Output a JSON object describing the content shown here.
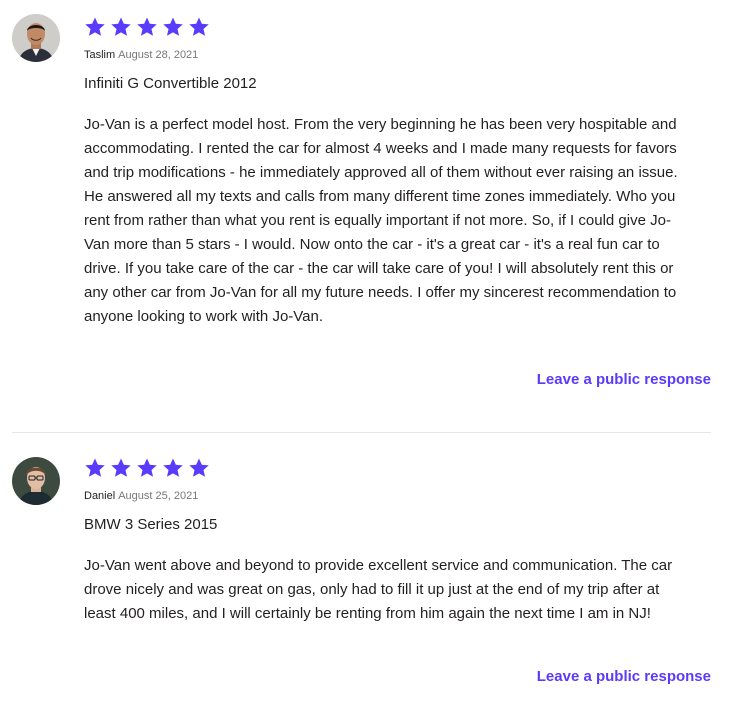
{
  "colors": {
    "accent": "#593cfb",
    "star": "#593cfb",
    "text": "#231f20",
    "muted": "#79767a",
    "divider": "#e5e5e5"
  },
  "reviews": [
    {
      "rating": 5,
      "star_icon": "star-icon",
      "reviewer": "Taslim",
      "date": "August 28, 2021",
      "car": "Infiniti G Convertible 2012",
      "text": "Jo-Van is a perfect model host. From the very beginning he has been very hospitable and accommodating. I rented the car for almost 4 weeks and I made many requests for favors and trip modifications - he immediately approved all of them without ever raising an issue. He answered all my texts and calls from many different time zones immediately. Who you rent from rather than what you rent is equally important if not more. So, if I could give Jo-Van more than 5 stars - I would. Now onto the car - it's a great car - it's a real fun car to drive. If you take care of the car - the car will take care of you! I will absolutely rent this or any other car from Jo-Van for all my future needs. I offer my sincerest recommendation to anyone looking to work with Jo-Van.",
      "response_label": "Leave a public response"
    },
    {
      "rating": 5,
      "star_icon": "star-icon",
      "reviewer": "Daniel",
      "date": "August 25, 2021",
      "car": "BMW 3 Series 2015",
      "text": "Jo-Van went above and beyond to provide excellent service and communication. The car drove nicely and was great on gas, only had to fill it up just at the end of my trip after at least 400 miles, and I will certainly be renting from him again the next time I am in NJ!",
      "response_label": "Leave a public response"
    }
  ]
}
